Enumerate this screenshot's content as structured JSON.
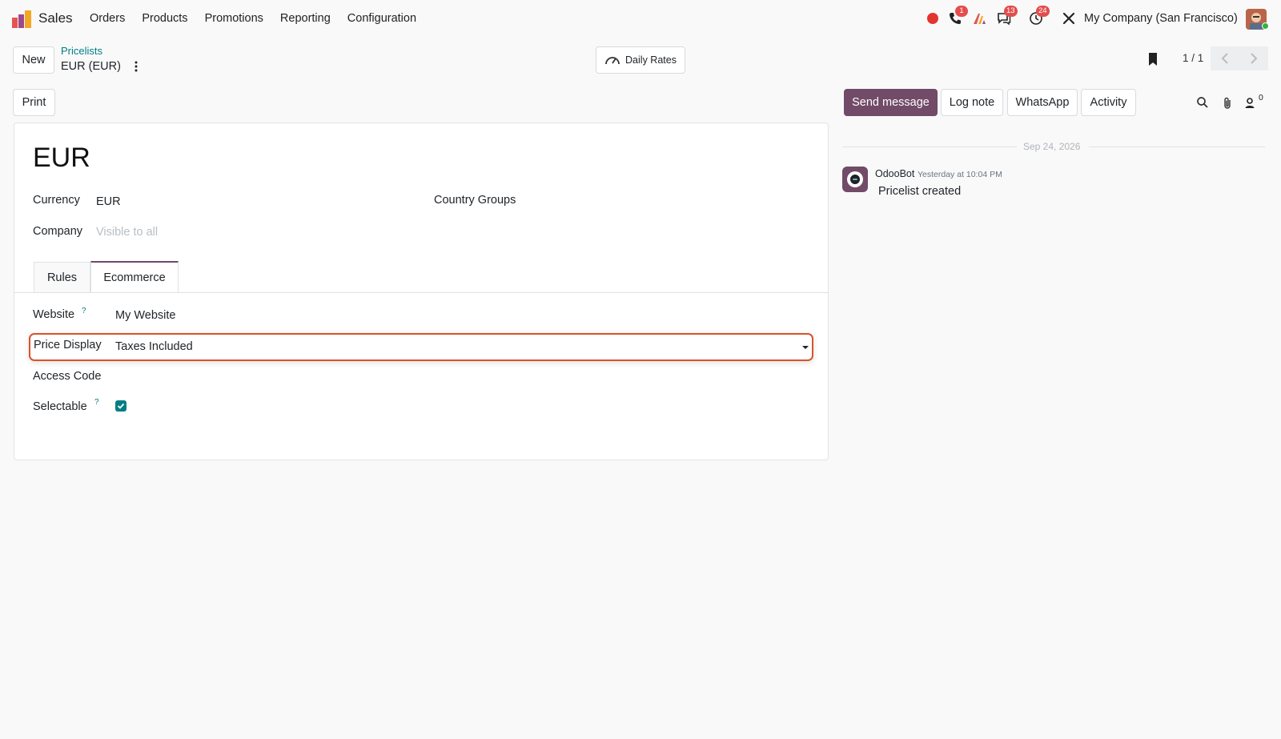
{
  "topbar": {
    "app_name": "Sales",
    "menu": [
      "Orders",
      "Products",
      "Promotions",
      "Reporting",
      "Configuration"
    ],
    "badges": {
      "phone": "1",
      "messages": "13",
      "activities": "24"
    },
    "company": "My Company (San Francisco)"
  },
  "control_panel": {
    "new_label": "New",
    "breadcrumb_parent": "Pricelists",
    "breadcrumb_current": "EUR (EUR)",
    "daily_rates_label": "Daily Rates",
    "pager": "1 / 1",
    "print_label": "Print"
  },
  "form": {
    "name": "EUR",
    "currency_label": "Currency",
    "currency_value": "EUR",
    "country_groups_label": "Country Groups",
    "company_label": "Company",
    "company_placeholder": "Visible to all",
    "tabs": [
      "Rules",
      "Ecommerce"
    ],
    "website_label": "Website",
    "website_value": "My Website",
    "price_display_label": "Price Display",
    "price_display_value": "Taxes Included",
    "access_code_label": "Access Code",
    "selectable_label": "Selectable",
    "help_mark": "?"
  },
  "chatter": {
    "send_message": "Send message",
    "log_note": "Log note",
    "whatsapp": "WhatsApp",
    "activity": "Activity",
    "followers_count": "0",
    "date": "Sep 24, 2026",
    "author": "OdooBot",
    "time": "Yesterday at 10:04 PM",
    "body": "Pricelist created"
  },
  "colors": {
    "brand": "#714b67",
    "link": "#017e84",
    "highlight": "#d9532a"
  }
}
